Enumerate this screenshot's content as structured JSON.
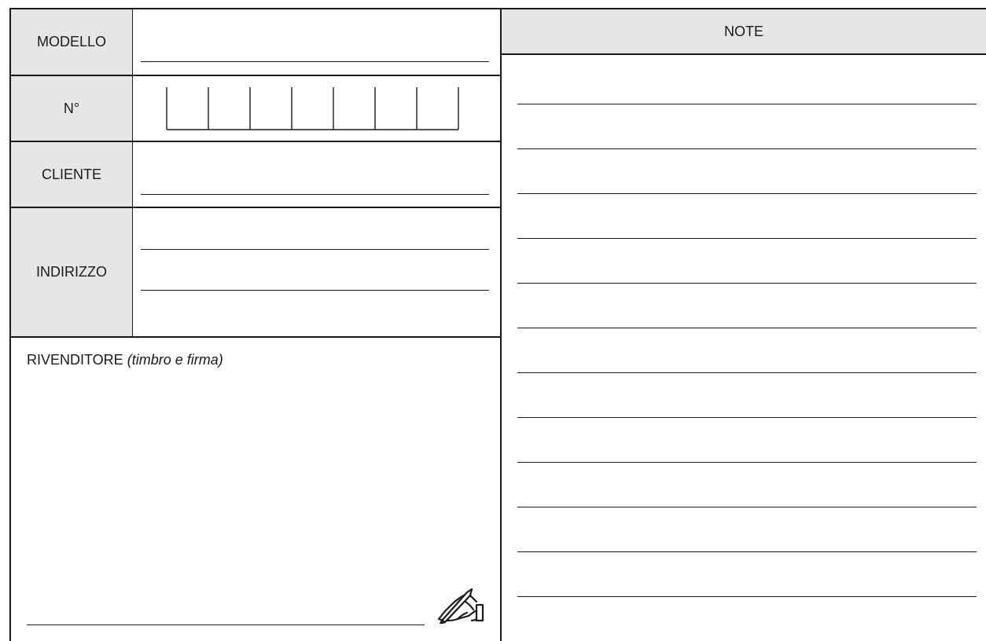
{
  "form": {
    "modello_label": "MODELLO",
    "numero_label": "N°",
    "cliente_label": "CLIENTE",
    "indirizzo_label": "INDIRIZZO",
    "rivenditore_label": "RIVENDITORE",
    "rivenditore_hint": "(timbro e firma)",
    "serial_boxes": 7
  },
  "notes": {
    "header": "NOTE",
    "line_count": 12
  },
  "icons": {
    "signature": "pen-writing-icon"
  }
}
